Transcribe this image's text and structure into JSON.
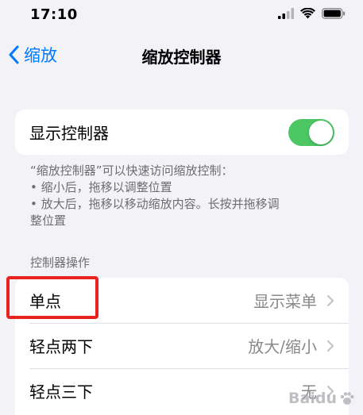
{
  "status_bar": {
    "time": "17:10"
  },
  "nav": {
    "back_label": "缩放",
    "title": "缩放控制器"
  },
  "toggle_row": {
    "label": "显示控制器",
    "enabled": true
  },
  "description": {
    "lines": [
      "“缩放控制器”可以快速访问缩放控制：",
      "• 缩小后，拖移以调整位置",
      "• 放大后，拖移以移动缩放内容。长按并拖移调",
      "整位置"
    ]
  },
  "section": {
    "header": "控制器操作"
  },
  "actions": [
    {
      "label": "单点",
      "value": "显示菜单"
    },
    {
      "label": "轻点两下",
      "value": "放大/缩小"
    },
    {
      "label": "轻点三下",
      "value": "无"
    }
  ],
  "watermark": {
    "text": "Baidu"
  },
  "colors": {
    "accent": "#007aff",
    "toggle_on": "#4cc764",
    "highlight": "#e8231f",
    "background": "#f2f2f7"
  }
}
